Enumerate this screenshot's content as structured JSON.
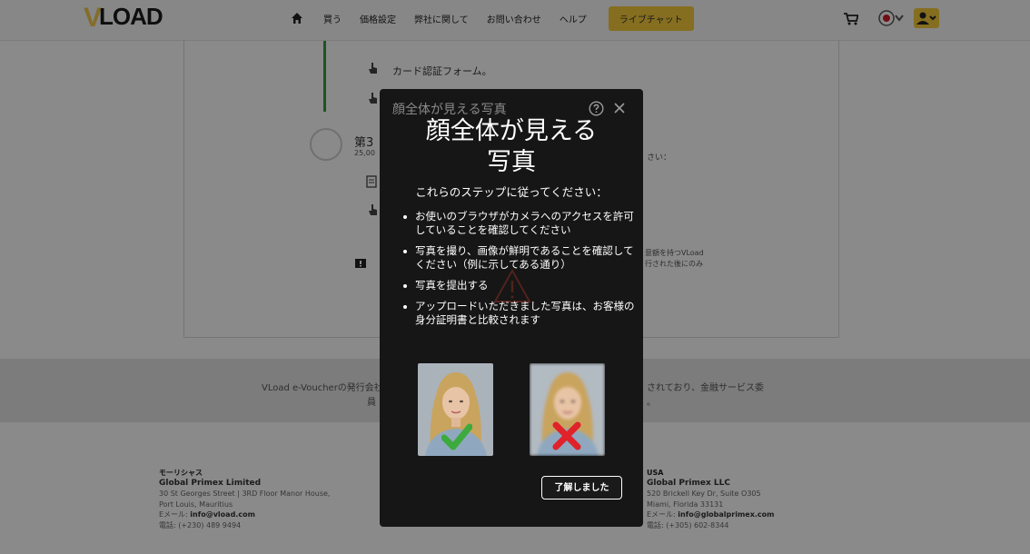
{
  "brand": {
    "logo_text": "LOAD"
  },
  "nav": {
    "links": [
      "買う",
      "価格設定",
      "弊社に関して",
      "お問い合わせ",
      "ヘルプ"
    ],
    "live_chat": "ライブチャット"
  },
  "background": {
    "step_item_1": "カード認証フォーム。",
    "step_3_label": "第3",
    "step_3_amount": "25,00",
    "right_fragment": "さい：",
    "note_line1": "意額を持つVLoad",
    "note_line2": "行された後にのみ",
    "footer_line1_left": "VLoad e-Voucherの発行会社",
    "footer_line1_right": "されており、金融サービス委",
    "footer_line2_left": "員",
    "footer_line2_right": "。"
  },
  "addresses": {
    "left": {
      "region": "モーリシャス",
      "company": "Global Primex Limited",
      "line1": "30 St Georges Street | 3RD Floor Manor House,",
      "line2": "Port Louis, Mauritius",
      "email_label": "Eメール: ",
      "email": "info@vload.com",
      "phone": "電話: (+230) 489 9494"
    },
    "right": {
      "region": "USA",
      "company": "Global Primex LLC",
      "line1": "520 Brickell Key Dr, Suite O305",
      "line2": "Miami, Florida 33131",
      "email_label": "Eメール: ",
      "email": "info@globalprimex.com",
      "phone": "電話: (+305) 602-8344"
    }
  },
  "modal": {
    "header_title": "顔全体が見える写真",
    "title_line1": "顔全体が見える",
    "title_line2": "写真",
    "subtitle": "これらのステップに従ってください：",
    "steps": [
      "お使いのブラウザがカメラへのアクセスを許可していることを確認してください",
      "写真を撮り、画像が鮮明であることを確認してください（例に示してある通り）",
      "写真を提出する",
      "アップロードいただきました写真は、お客様の身分証明書と比較されます"
    ],
    "ok_button": "了解しました"
  },
  "colors": {
    "accent_yellow": "#f5cc3a",
    "success_green": "#3e9a3e",
    "error_red": "#e0222a",
    "modal_bg": "#161616"
  },
  "icons": {
    "home": "home-icon",
    "cart": "cart-icon",
    "language": "language-flag-icon",
    "user": "user-icon",
    "help": "help-icon",
    "close": "close-icon",
    "good_mark": "checkmark-icon",
    "bad_mark": "x-mark-icon"
  }
}
